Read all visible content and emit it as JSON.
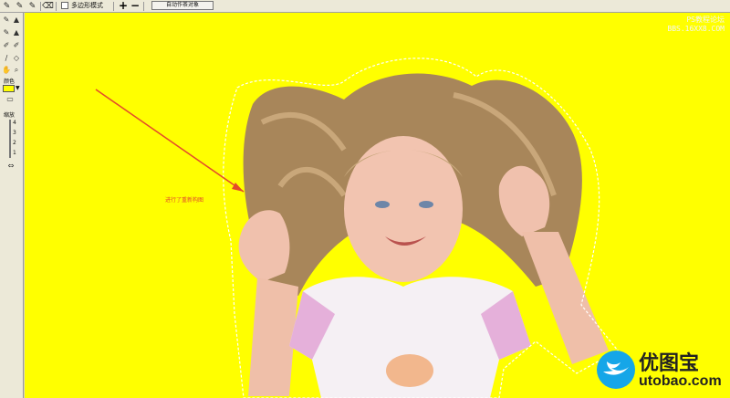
{
  "toolbar": {
    "multi_select_label": "多边形模式",
    "auto_button_label": "自动作茶对象",
    "plus_label": "+",
    "minus_label": "−"
  },
  "sidebar": {
    "color_label": "颜色",
    "zoom_label": "缩放",
    "scale_ticks": [
      "4",
      "3",
      "2",
      "1"
    ]
  },
  "canvas": {
    "annotation": "进行了重新构图",
    "background_color": "#ffff00"
  },
  "watermarks": {
    "top_line1": "PS教程论坛",
    "top_line2": "BBS.16XX8.COM",
    "bottom_title": "优图宝",
    "bottom_domain": "utobao.com"
  }
}
